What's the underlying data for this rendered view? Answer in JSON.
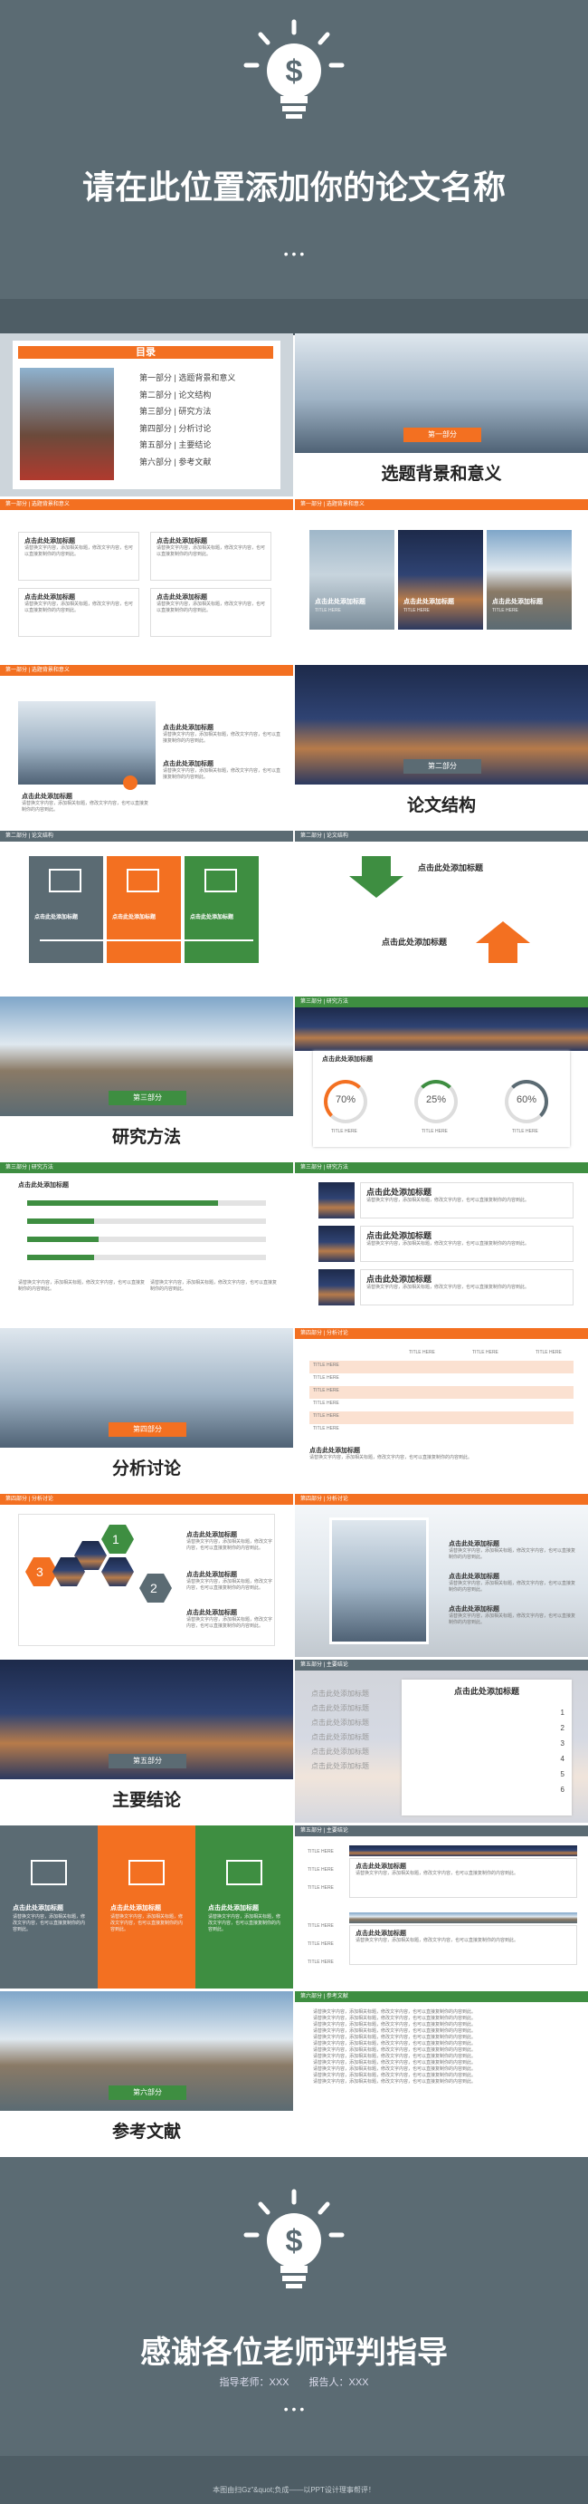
{
  "cover": {
    "title": "请在此位置添加你的论文名称",
    "dots": "• • •"
  },
  "toc": {
    "heading": "目录",
    "items": [
      "第一部分 | 选题背景和意义",
      "第二部分 | 论文结构",
      "第三部分 | 研究方法",
      "第四部分 | 分析讨论",
      "第五部分 | 主要结论",
      "第六部分 | 参考文献"
    ]
  },
  "sections": {
    "s1": {
      "badge": "第一部分",
      "title": "选题背景和意义"
    },
    "s2": {
      "badge": "第二部分",
      "title": "论文结构"
    },
    "s3": {
      "badge": "第三部分",
      "title": "研究方法"
    },
    "s4": {
      "badge": "第四部分",
      "title": "分析讨论"
    },
    "s5": {
      "badge": "第五部分",
      "title": "主要结论"
    },
    "s6": {
      "badge": "第六部分",
      "title": "参考文献"
    }
  },
  "headers": {
    "p1": "第一部分 | 选题背景和意义",
    "p2": "第二部分 | 论文结构",
    "p3": "第三部分 | 研究方法",
    "p4": "第四部分 | 分析讨论",
    "p5": "第五部分 | 主要结论",
    "p6": "第六部分 | 参考文献"
  },
  "common": {
    "clickTitle": "点击此处添加标题",
    "title_here": "TITLE HERE",
    "body": "请替换文字内容，添加相关标题，修改文字内容，也可以直接复制你的内容到此。"
  },
  "gauges": [
    "70%",
    "25%",
    "60%"
  ],
  "numbered": [
    "1",
    "2",
    "3",
    "4",
    "5",
    "6"
  ],
  "hexNums": [
    "1",
    "2",
    "3"
  ],
  "bars": [
    0.8,
    0.28,
    0.3,
    0.28
  ],
  "ending": {
    "title": "感谢各位老师评判指导",
    "sub": "指导老师：XXX　　报告人：XXX",
    "dots": "• • •",
    "footer": "本图由扫Gz\"&quot;负成——以PPT设计理事帮评！"
  }
}
